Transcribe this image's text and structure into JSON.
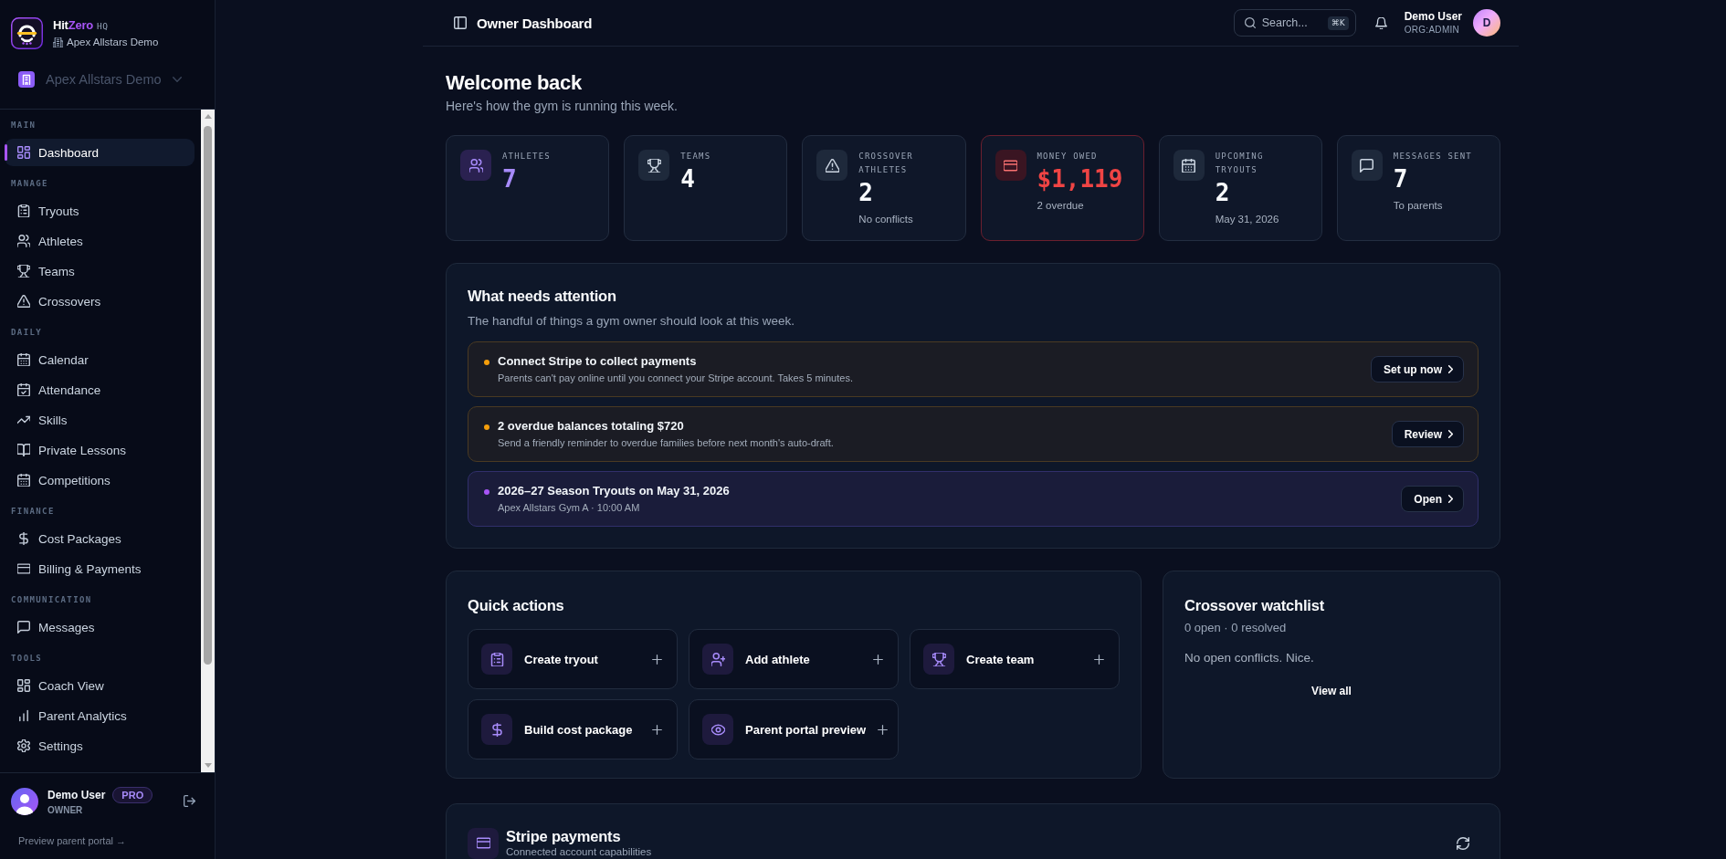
{
  "sidebar": {
    "brand": {
      "name_parts": [
        "Hit",
        "Zero"
      ],
      "suffix": "HQ",
      "org": "Apex Allstars Demo"
    },
    "org_switcher": {
      "label": "Apex Allstars Demo"
    },
    "sections": [
      {
        "label": "MAIN",
        "items": [
          {
            "label": "Dashboard",
            "selected": true
          }
        ]
      },
      {
        "label": "MANAGE",
        "items": [
          {
            "label": "Tryouts",
            "selected": false
          },
          {
            "label": "Athletes",
            "selected": false
          },
          {
            "label": "Teams",
            "selected": false
          },
          {
            "label": "Crossovers",
            "selected": false
          }
        ]
      },
      {
        "label": "DAILY",
        "items": [
          {
            "label": "Calendar",
            "selected": false
          },
          {
            "label": "Attendance",
            "selected": false
          },
          {
            "label": "Skills",
            "selected": false
          },
          {
            "label": "Private Lessons",
            "selected": false
          },
          {
            "label": "Competitions",
            "selected": false
          }
        ]
      },
      {
        "label": "FINANCE",
        "items": [
          {
            "label": "Cost Packages",
            "selected": false
          },
          {
            "label": "Billing & Payments",
            "selected": false
          }
        ]
      },
      {
        "label": "COMMUNICATION",
        "items": [
          {
            "label": "Messages",
            "selected": false
          }
        ]
      },
      {
        "label": "TOOLS",
        "items": [
          {
            "label": "Coach View",
            "selected": false
          },
          {
            "label": "Parent Analytics",
            "selected": false
          },
          {
            "label": "Settings",
            "selected": false
          }
        ]
      }
    ],
    "user": {
      "name": "Demo User",
      "badge": "PRO",
      "role": "OWNER"
    },
    "footer_link": "Preview parent portal →"
  },
  "header": {
    "title": "Owner Dashboard",
    "search": {
      "label": "Search...",
      "shortcut": "⌘K"
    },
    "user": {
      "name": "Demo User",
      "role": "ORG:ADMIN",
      "initial": "D"
    }
  },
  "welcome": {
    "title": "Welcome back",
    "subtitle": "Here's how the gym is running this week."
  },
  "stats": [
    {
      "label": "ATHLETES",
      "value": "7",
      "kind": "accent"
    },
    {
      "label": "TEAMS",
      "value": "4",
      "kind": "plain"
    },
    {
      "label": "CROSSOVER ATHLETES",
      "value": "2",
      "detail": "No conflicts",
      "kind": "plain"
    },
    {
      "label": "MONEY OWED",
      "value": "$1,119",
      "detail": "2 overdue",
      "kind": "alert"
    },
    {
      "label": "UPCOMING TRYOUTS",
      "value": "2",
      "detail": "May 31, 2026",
      "kind": "plain"
    },
    {
      "label": "MESSAGES SENT",
      "value": "7",
      "detail": "To parents",
      "kind": "plain"
    }
  ],
  "attention": {
    "title": "What needs attention",
    "subtitle": "The handful of things a gym owner should look at this week.",
    "items": [
      {
        "kind": "warning",
        "title": "Connect Stripe to collect payments",
        "detail": "Parents can't pay online until you connect your Stripe account. Takes 5 minutes.",
        "action": "Set up now"
      },
      {
        "kind": "warning",
        "title": "2 overdue balances totaling $720",
        "detail": "Send a friendly reminder to overdue families before next month's auto-draft.",
        "action": "Review"
      },
      {
        "kind": "event",
        "title": "2026–27 Season Tryouts on May 31, 2026",
        "detail": "Apex Allstars Gym A · 10:00 AM",
        "action": "Open"
      }
    ]
  },
  "quick_actions": {
    "title": "Quick actions",
    "items": [
      "Create tryout",
      "Add athlete",
      "Create team",
      "Build cost package",
      "Parent portal preview"
    ]
  },
  "crossover_watchlist": {
    "title": "Crossover watchlist",
    "summary": "0 open · 0 resolved",
    "message": "No open conflicts. Nice.",
    "link": "View all"
  },
  "stripe_payments": {
    "title": "Stripe payments",
    "subtitle": "Connected account capabilities"
  }
}
